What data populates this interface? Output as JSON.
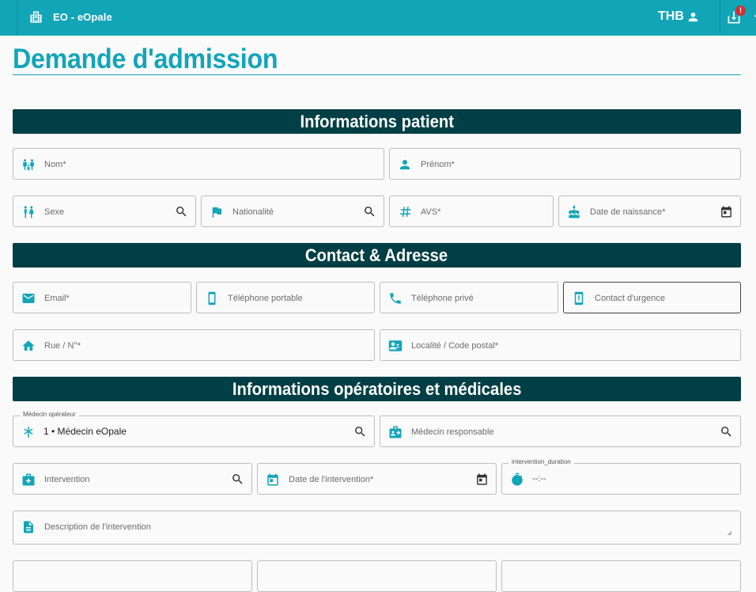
{
  "header": {
    "app_title": "EO -  eOpale",
    "user_initials": "THB",
    "notification_count": "!"
  },
  "page": {
    "title": "Demande d'admission"
  },
  "sections": {
    "patient": "Informations patient",
    "contact": "Contact & Adresse",
    "medical": "Informations opératoires et médicales"
  },
  "patient": {
    "nom": "Nom*",
    "prenom": "Prénom*",
    "sexe": "Sexe",
    "nationalite": "Nationalité",
    "avs": "AVS*",
    "date_naissance": "Date de naissance*"
  },
  "contact": {
    "email": "Email*",
    "tel_portable": "Téléphone portable",
    "tel_prive": "Téléphone privé",
    "contact_urgence": "Contact d'urgence",
    "rue": "Rue / N°*",
    "localite": "Localité / Code postal*"
  },
  "medical": {
    "medecin_operateur_label": "Médecin opérateur",
    "medecin_operateur_value": "1 • Médecin eOpale",
    "medecin_responsable": "Médecin responsable",
    "intervention": "Intervention",
    "date_intervention": "Date de l'intervention*",
    "duration_label": "intervention_duration",
    "duration_value": "--:--",
    "description": "Description de l'intervention"
  },
  "icons": {
    "accent_color": "#12a5b8",
    "section_color": "#003f45"
  }
}
